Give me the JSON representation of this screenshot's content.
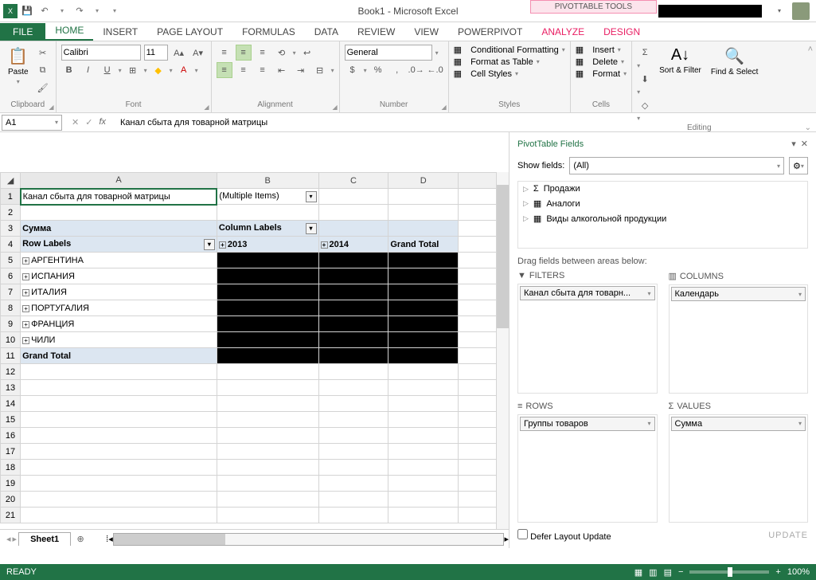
{
  "titlebar": {
    "title": "Book1 - Microsoft Excel",
    "contextual": "PIVOTTABLE TOOLS"
  },
  "tabs": {
    "file": "FILE",
    "home": "HOME",
    "insert": "INSERT",
    "pagelayout": "PAGE LAYOUT",
    "formulas": "FORMULAS",
    "data": "DATA",
    "review": "REVIEW",
    "view": "VIEW",
    "powerpivot": "POWERPIVOT",
    "analyze": "ANALYZE",
    "design": "DESIGN"
  },
  "ribbon": {
    "clipboard": {
      "label": "Clipboard",
      "paste": "Paste"
    },
    "font": {
      "label": "Font",
      "family": "Calibri",
      "size": "11"
    },
    "alignment": {
      "label": "Alignment"
    },
    "number": {
      "label": "Number",
      "format": "General"
    },
    "styles": {
      "label": "Styles",
      "cond": "Conditional Formatting",
      "table": "Format as Table",
      "cell": "Cell Styles"
    },
    "cells": {
      "label": "Cells",
      "insert": "Insert",
      "delete": "Delete",
      "format": "Format"
    },
    "editing": {
      "label": "Editing",
      "sort": "Sort & Filter",
      "find": "Find & Select"
    }
  },
  "formula_bar": {
    "name": "A1",
    "value": "Канал сбыта для товарной матрицы"
  },
  "grid": {
    "cols": [
      "A",
      "B",
      "C",
      "D"
    ],
    "r1": {
      "a": "Канал сбыта для товарной матрицы",
      "b": "(Multiple Items)"
    },
    "r3": {
      "a": "Сумма",
      "b": "Column Labels"
    },
    "r4": {
      "a": "Row Labels",
      "b": "2013",
      "c": "2014",
      "d": "Grand Total"
    },
    "r5": "АРГЕНТИНА",
    "r6": "ИСПАНИЯ",
    "r7": "ИТАЛИЯ",
    "r8": "ПОРТУГАЛИЯ",
    "r9": "ФРАНЦИЯ",
    "r10": "ЧИЛИ",
    "r11": "Grand Total"
  },
  "sheet": {
    "tab": "Sheet1"
  },
  "pane": {
    "title": "PivotTable Fields",
    "show": "Show fields:",
    "show_val": "(All)",
    "fields": [
      "Продажи",
      "Аналоги",
      "Виды алкогольной продукции"
    ],
    "drag": "Drag fields between areas below:",
    "filters": {
      "hdr": "FILTERS",
      "val": "Канал сбыта для товарн..."
    },
    "columns": {
      "hdr": "COLUMNS",
      "val": "Календарь"
    },
    "rows": {
      "hdr": "ROWS",
      "val": "Группы товаров"
    },
    "values": {
      "hdr": "VALUES",
      "val": "Сумма"
    },
    "defer": "Defer Layout Update",
    "update": "UPDATE"
  },
  "status": {
    "ready": "READY",
    "zoom": "100%"
  }
}
